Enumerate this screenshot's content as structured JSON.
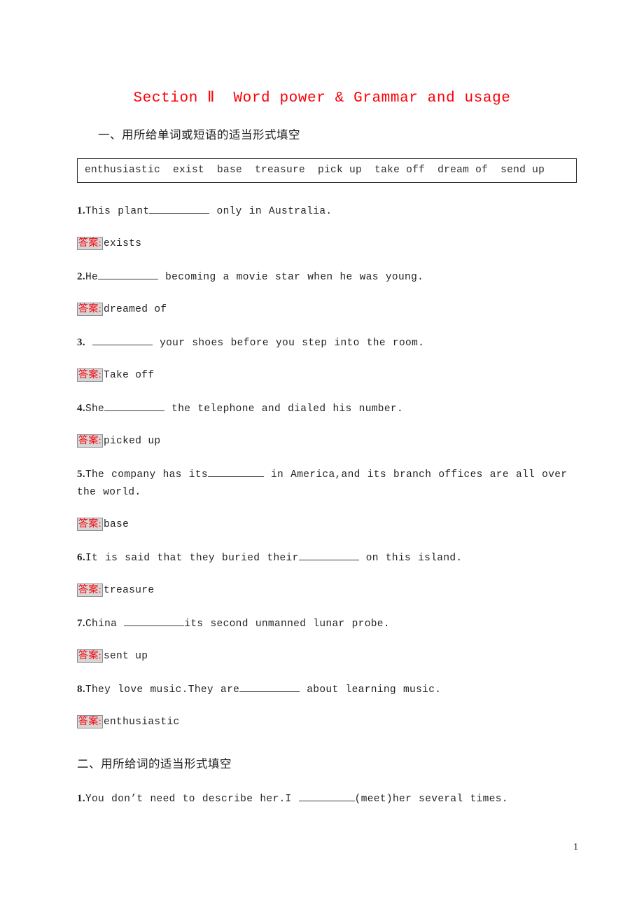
{
  "document": {
    "title": "Section Ⅱ  Word power & Grammar and usage",
    "title_color": "#fb0007",
    "page_number": "1"
  },
  "sections": [
    {
      "heading": "一、用所给单词或短语的适当形式填空",
      "word_bank": "enthusiastic  exist  base  treasure  pick up  take off  dream of  send up",
      "items": [
        {
          "number": "1.",
          "text_before": "This plant",
          "text_after": " only in Australia.",
          "answer_label": "答案",
          "answer_colon": ":",
          "answer_value": "exists"
        },
        {
          "number": "2.",
          "text_before": "He",
          "text_after": " becoming a movie star when he was young.",
          "answer_label": "答案",
          "answer_colon": ":",
          "answer_value": "dreamed of"
        },
        {
          "number": "3.",
          "text_before": " ",
          "text_after": " your shoes before you step into the room.",
          "answer_label": "答案",
          "answer_colon": ":",
          "answer_value": "Take off"
        },
        {
          "number": "4.",
          "text_before": "She",
          "text_after": " the telephone and dialed his number.",
          "answer_label": "答案",
          "answer_colon": ":",
          "answer_value": "picked up"
        },
        {
          "number": "5.",
          "text_before": "The company has its",
          "text_after": " in America,and its branch offices are all over the world.",
          "answer_label": "答案",
          "answer_colon": ":",
          "answer_value": "base"
        },
        {
          "number": "6.",
          "text_before": "It is said that they buried their",
          "text_after": " on this island.",
          "answer_label": "答案",
          "answer_colon": ":",
          "answer_value": "treasure"
        },
        {
          "number": "7.",
          "text_before": "China ",
          "text_after": "its second unmanned lunar probe.",
          "answer_label": "答案",
          "answer_colon": ":",
          "answer_value": "sent up"
        },
        {
          "number": "8.",
          "text_before": "They love music.They are",
          "text_after": " about learning music.",
          "answer_label": "答案",
          "answer_colon": ":",
          "answer_value": "enthusiastic"
        }
      ]
    },
    {
      "heading": "二、用所给词的适当形式填空",
      "items": [
        {
          "number": "1.",
          "text_before": "You don’t need to describe her.I ",
          "text_after": "(meet)her several times."
        }
      ]
    }
  ]
}
